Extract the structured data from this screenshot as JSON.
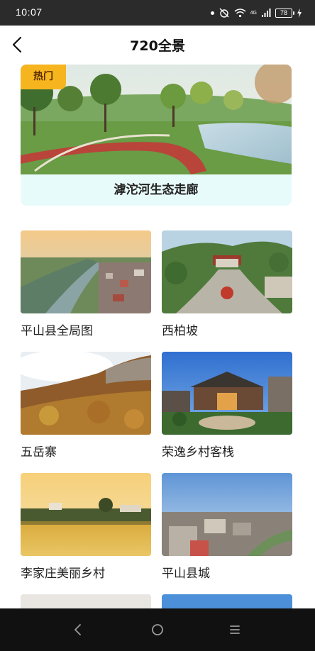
{
  "status_bar": {
    "time": "10:07",
    "network": "4G",
    "battery": "78"
  },
  "header": {
    "title": "720全景"
  },
  "featured": {
    "badge": "热门",
    "caption": "滹沱河生态走廊"
  },
  "places": [
    {
      "name": "平山县全局图"
    },
    {
      "name": "西柏坡"
    },
    {
      "name": "五岳寨"
    },
    {
      "name": "荣逸乡村客栈"
    },
    {
      "name": "李家庄美丽乡村"
    },
    {
      "name": "平山县城"
    }
  ],
  "colors": {
    "badge": "#f6b51e",
    "caption_bg": "#e8fbfb",
    "status_bar": "#2b2b2b",
    "nav_bar": "#111111"
  },
  "icons": {
    "back": "chevron-left-icon",
    "nav_back": "triangle-back-icon",
    "nav_home": "circle-home-icon",
    "nav_menu": "menu-icon"
  }
}
